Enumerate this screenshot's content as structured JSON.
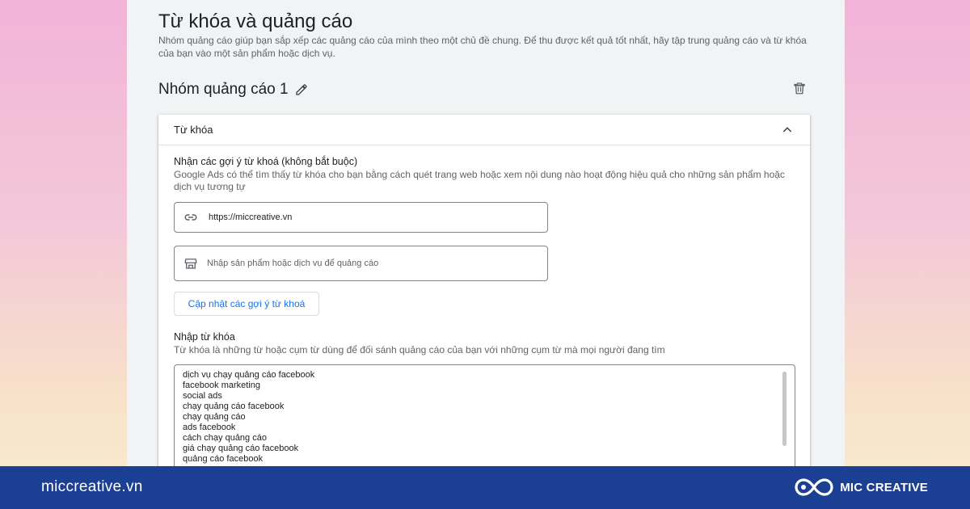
{
  "section": {
    "title": "Từ khóa và quảng cáo",
    "description": "Nhóm quảng cáo giúp bạn sắp xếp các quảng cáo của mình theo một chủ đề chung. Để thu được kết quả tốt nhất, hãy tập trung quảng cáo và từ khóa của bạn vào một sản phẩm hoặc dịch vụ."
  },
  "ad_group": {
    "title": "Nhóm quảng cáo 1",
    "edit_icon": "pencil-icon",
    "delete_icon": "trash-icon"
  },
  "keywords_card": {
    "header": "Từ khóa",
    "collapse_icon": "chevron-up-icon",
    "suggestions": {
      "title": "Nhận các gợi ý từ khoá (không bắt buộc)",
      "description": "Google Ads có thể tìm thấy từ khóa cho bạn bằng cách quét trang web hoặc xem nội dung nào hoạt động hiệu quả cho những sản phẩm hoặc dịch vụ tương tự",
      "url_field": {
        "icon": "link-icon",
        "value": "https://miccreative.vn"
      },
      "product_field": {
        "icon": "storefront-icon",
        "placeholder": "Nhập sản phẩm hoặc dịch vụ để quảng cáo"
      },
      "update_button": "Cập nhật các gợi ý từ khoá"
    },
    "enter_keywords": {
      "title": "Nhập từ khóa",
      "description": "Từ khóa là những từ hoặc cụm từ dùng để đối sánh quảng cáo của bạn với những cụm từ mà mọi người đang tìm",
      "keywords": [
        "dịch vụ chạy quảng cáo facebook",
        "facebook marketing",
        "social ads",
        "chạy quảng cáo facebook",
        "chạy quảng cáo",
        "ads facebook",
        "cách chạy quảng cáo",
        "giá chạy quảng cáo facebook",
        "quảng cáo facebook"
      ]
    }
  },
  "footer": {
    "site": "miccreative.vn",
    "brand": "MIC CREATIVE",
    "logo_icon": "infinity-logo-icon"
  },
  "colors": {
    "accent": "#1a73e8",
    "footer_bg": "#1b3f93",
    "panel_bg": "#f1f3f4"
  }
}
